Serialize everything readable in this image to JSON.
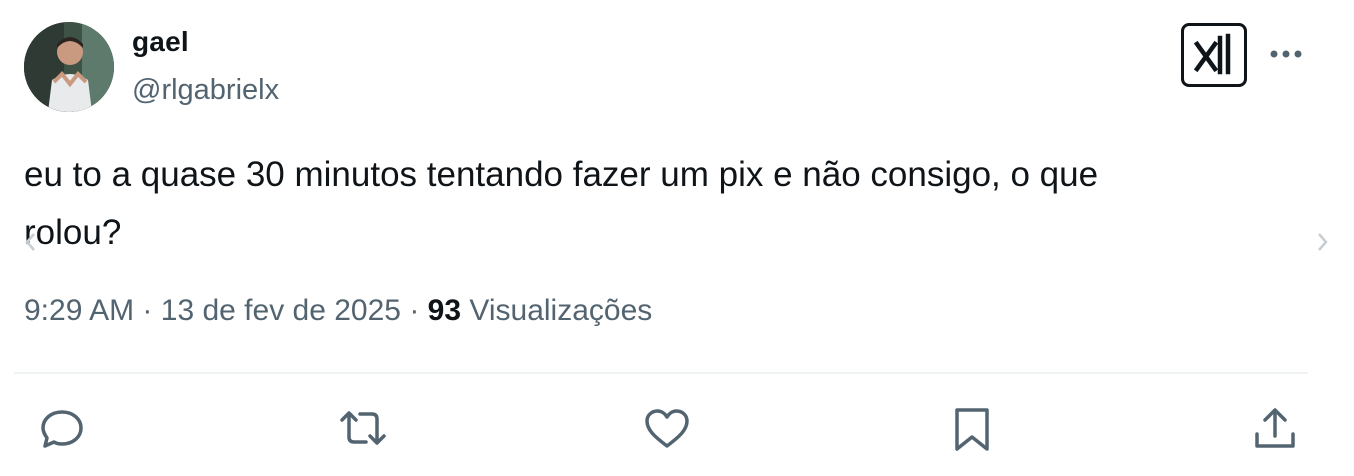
{
  "author": {
    "display_name": "gael",
    "handle": "@rlgabrielx",
    "avatar_icon": "user-photo"
  },
  "header_icons": {
    "logo_icon": "xai-logo-icon",
    "more_icon": "more-options-icon"
  },
  "tweet": {
    "text": "eu to a quase 30 minutos tentando fazer um pix e não consigo, o que\nrolou?"
  },
  "meta": {
    "time": "9:29 AM",
    "separator": "·",
    "date": "13 de fev de 2025",
    "views_count": "93",
    "views_label": "Visualizações"
  },
  "actions": [
    {
      "icon": "reply-icon"
    },
    {
      "icon": "retweet-icon"
    },
    {
      "icon": "like-icon"
    },
    {
      "icon": "bookmark-icon"
    },
    {
      "icon": "share-icon"
    }
  ],
  "colors": {
    "text_primary": "#0f1419",
    "text_secondary": "#536471",
    "divider": "#eff3f4"
  }
}
